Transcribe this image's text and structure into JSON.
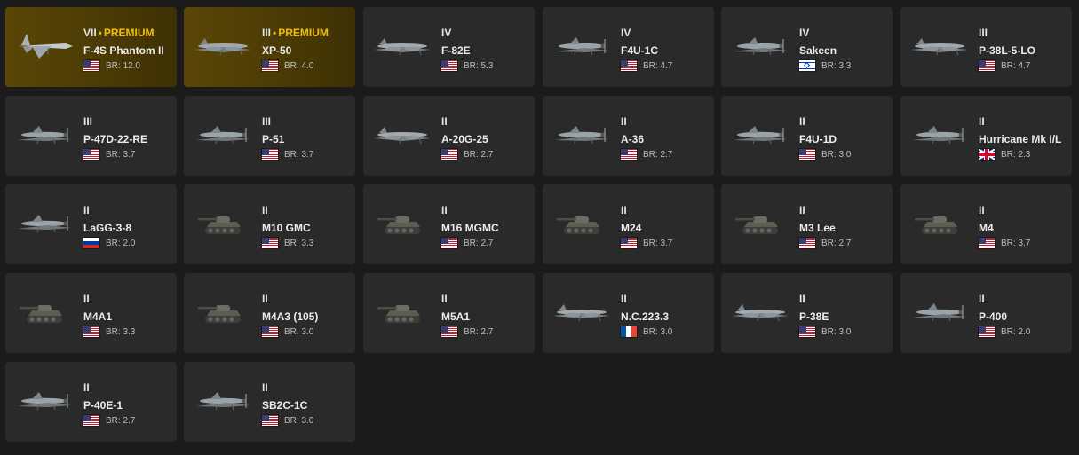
{
  "vehicles": [
    {
      "rank": "VII",
      "premium": "PREMIUM",
      "name": "F-4S Phantom II",
      "country": "us",
      "br": "BR: 12.0",
      "kind": "jet"
    },
    {
      "rank": "III",
      "premium": "PREMIUM",
      "name": "XP-50",
      "country": "us",
      "br": "BR: 4.0",
      "kind": "twin"
    },
    {
      "rank": "IV",
      "premium": "",
      "name": "F-82E",
      "country": "us",
      "br": "BR: 5.3",
      "kind": "twin"
    },
    {
      "rank": "IV",
      "premium": "",
      "name": "F4U-1C",
      "country": "us",
      "br": "BR: 4.7",
      "kind": "plane"
    },
    {
      "rank": "IV",
      "premium": "",
      "name": "Sakeen",
      "country": "il",
      "br": "BR: 3.3",
      "kind": "plane"
    },
    {
      "rank": "III",
      "premium": "",
      "name": "P-38L-5-LO",
      "country": "us",
      "br": "BR: 4.7",
      "kind": "twin"
    },
    {
      "rank": "III",
      "premium": "",
      "name": "P-47D-22-RE",
      "country": "us",
      "br": "BR: 3.7",
      "kind": "plane"
    },
    {
      "rank": "III",
      "premium": "",
      "name": "P-51",
      "country": "us",
      "br": "BR: 3.7",
      "kind": "plane"
    },
    {
      "rank": "II",
      "premium": "",
      "name": "A-20G-25",
      "country": "us",
      "br": "BR: 2.7",
      "kind": "twin"
    },
    {
      "rank": "II",
      "premium": "",
      "name": "A-36",
      "country": "us",
      "br": "BR: 2.7",
      "kind": "plane"
    },
    {
      "rank": "II",
      "premium": "",
      "name": "F4U-1D",
      "country": "us",
      "br": "BR: 3.0",
      "kind": "plane"
    },
    {
      "rank": "II",
      "premium": "",
      "name": "Hurricane Mk I/L",
      "country": "uk",
      "br": "BR: 2.3",
      "kind": "plane"
    },
    {
      "rank": "II",
      "premium": "",
      "name": "LaGG-3-8",
      "country": "ru",
      "br": "BR: 2.0",
      "kind": "plane"
    },
    {
      "rank": "II",
      "premium": "",
      "name": "M10 GMC",
      "country": "us",
      "br": "BR: 3.3",
      "kind": "tank"
    },
    {
      "rank": "II",
      "premium": "",
      "name": "M16 MGMC",
      "country": "us",
      "br": "BR: 2.7",
      "kind": "tank"
    },
    {
      "rank": "II",
      "premium": "",
      "name": "M24",
      "country": "us",
      "br": "BR: 3.7",
      "kind": "tank"
    },
    {
      "rank": "II",
      "premium": "",
      "name": "M3 Lee",
      "country": "us",
      "br": "BR: 2.7",
      "kind": "tank"
    },
    {
      "rank": "II",
      "premium": "",
      "name": "M4",
      "country": "us",
      "br": "BR: 3.7",
      "kind": "tank"
    },
    {
      "rank": "II",
      "premium": "",
      "name": "M4A1",
      "country": "us",
      "br": "BR: 3.3",
      "kind": "tank"
    },
    {
      "rank": "II",
      "premium": "",
      "name": "M4A3 (105)",
      "country": "us",
      "br": "BR: 3.0",
      "kind": "tank"
    },
    {
      "rank": "II",
      "premium": "",
      "name": "M5A1",
      "country": "us",
      "br": "BR: 2.7",
      "kind": "tank"
    },
    {
      "rank": "II",
      "premium": "",
      "name": "N.C.223.3",
      "country": "fr",
      "br": "BR: 3.0",
      "kind": "twin"
    },
    {
      "rank": "II",
      "premium": "",
      "name": "P-38E",
      "country": "us",
      "br": "BR: 3.0",
      "kind": "twin"
    },
    {
      "rank": "II",
      "premium": "",
      "name": "P-400",
      "country": "us",
      "br": "BR: 2.0",
      "kind": "plane"
    },
    {
      "rank": "II",
      "premium": "",
      "name": "P-40E-1",
      "country": "us",
      "br": "BR: 2.7",
      "kind": "plane"
    },
    {
      "rank": "II",
      "premium": "",
      "name": "SB2C-1C",
      "country": "us",
      "br": "BR: 3.0",
      "kind": "plane"
    }
  ],
  "colors": {
    "premium_text": "#f0bf10",
    "card_bg": "#2a2a2a",
    "page_bg": "#1b1b1b"
  }
}
